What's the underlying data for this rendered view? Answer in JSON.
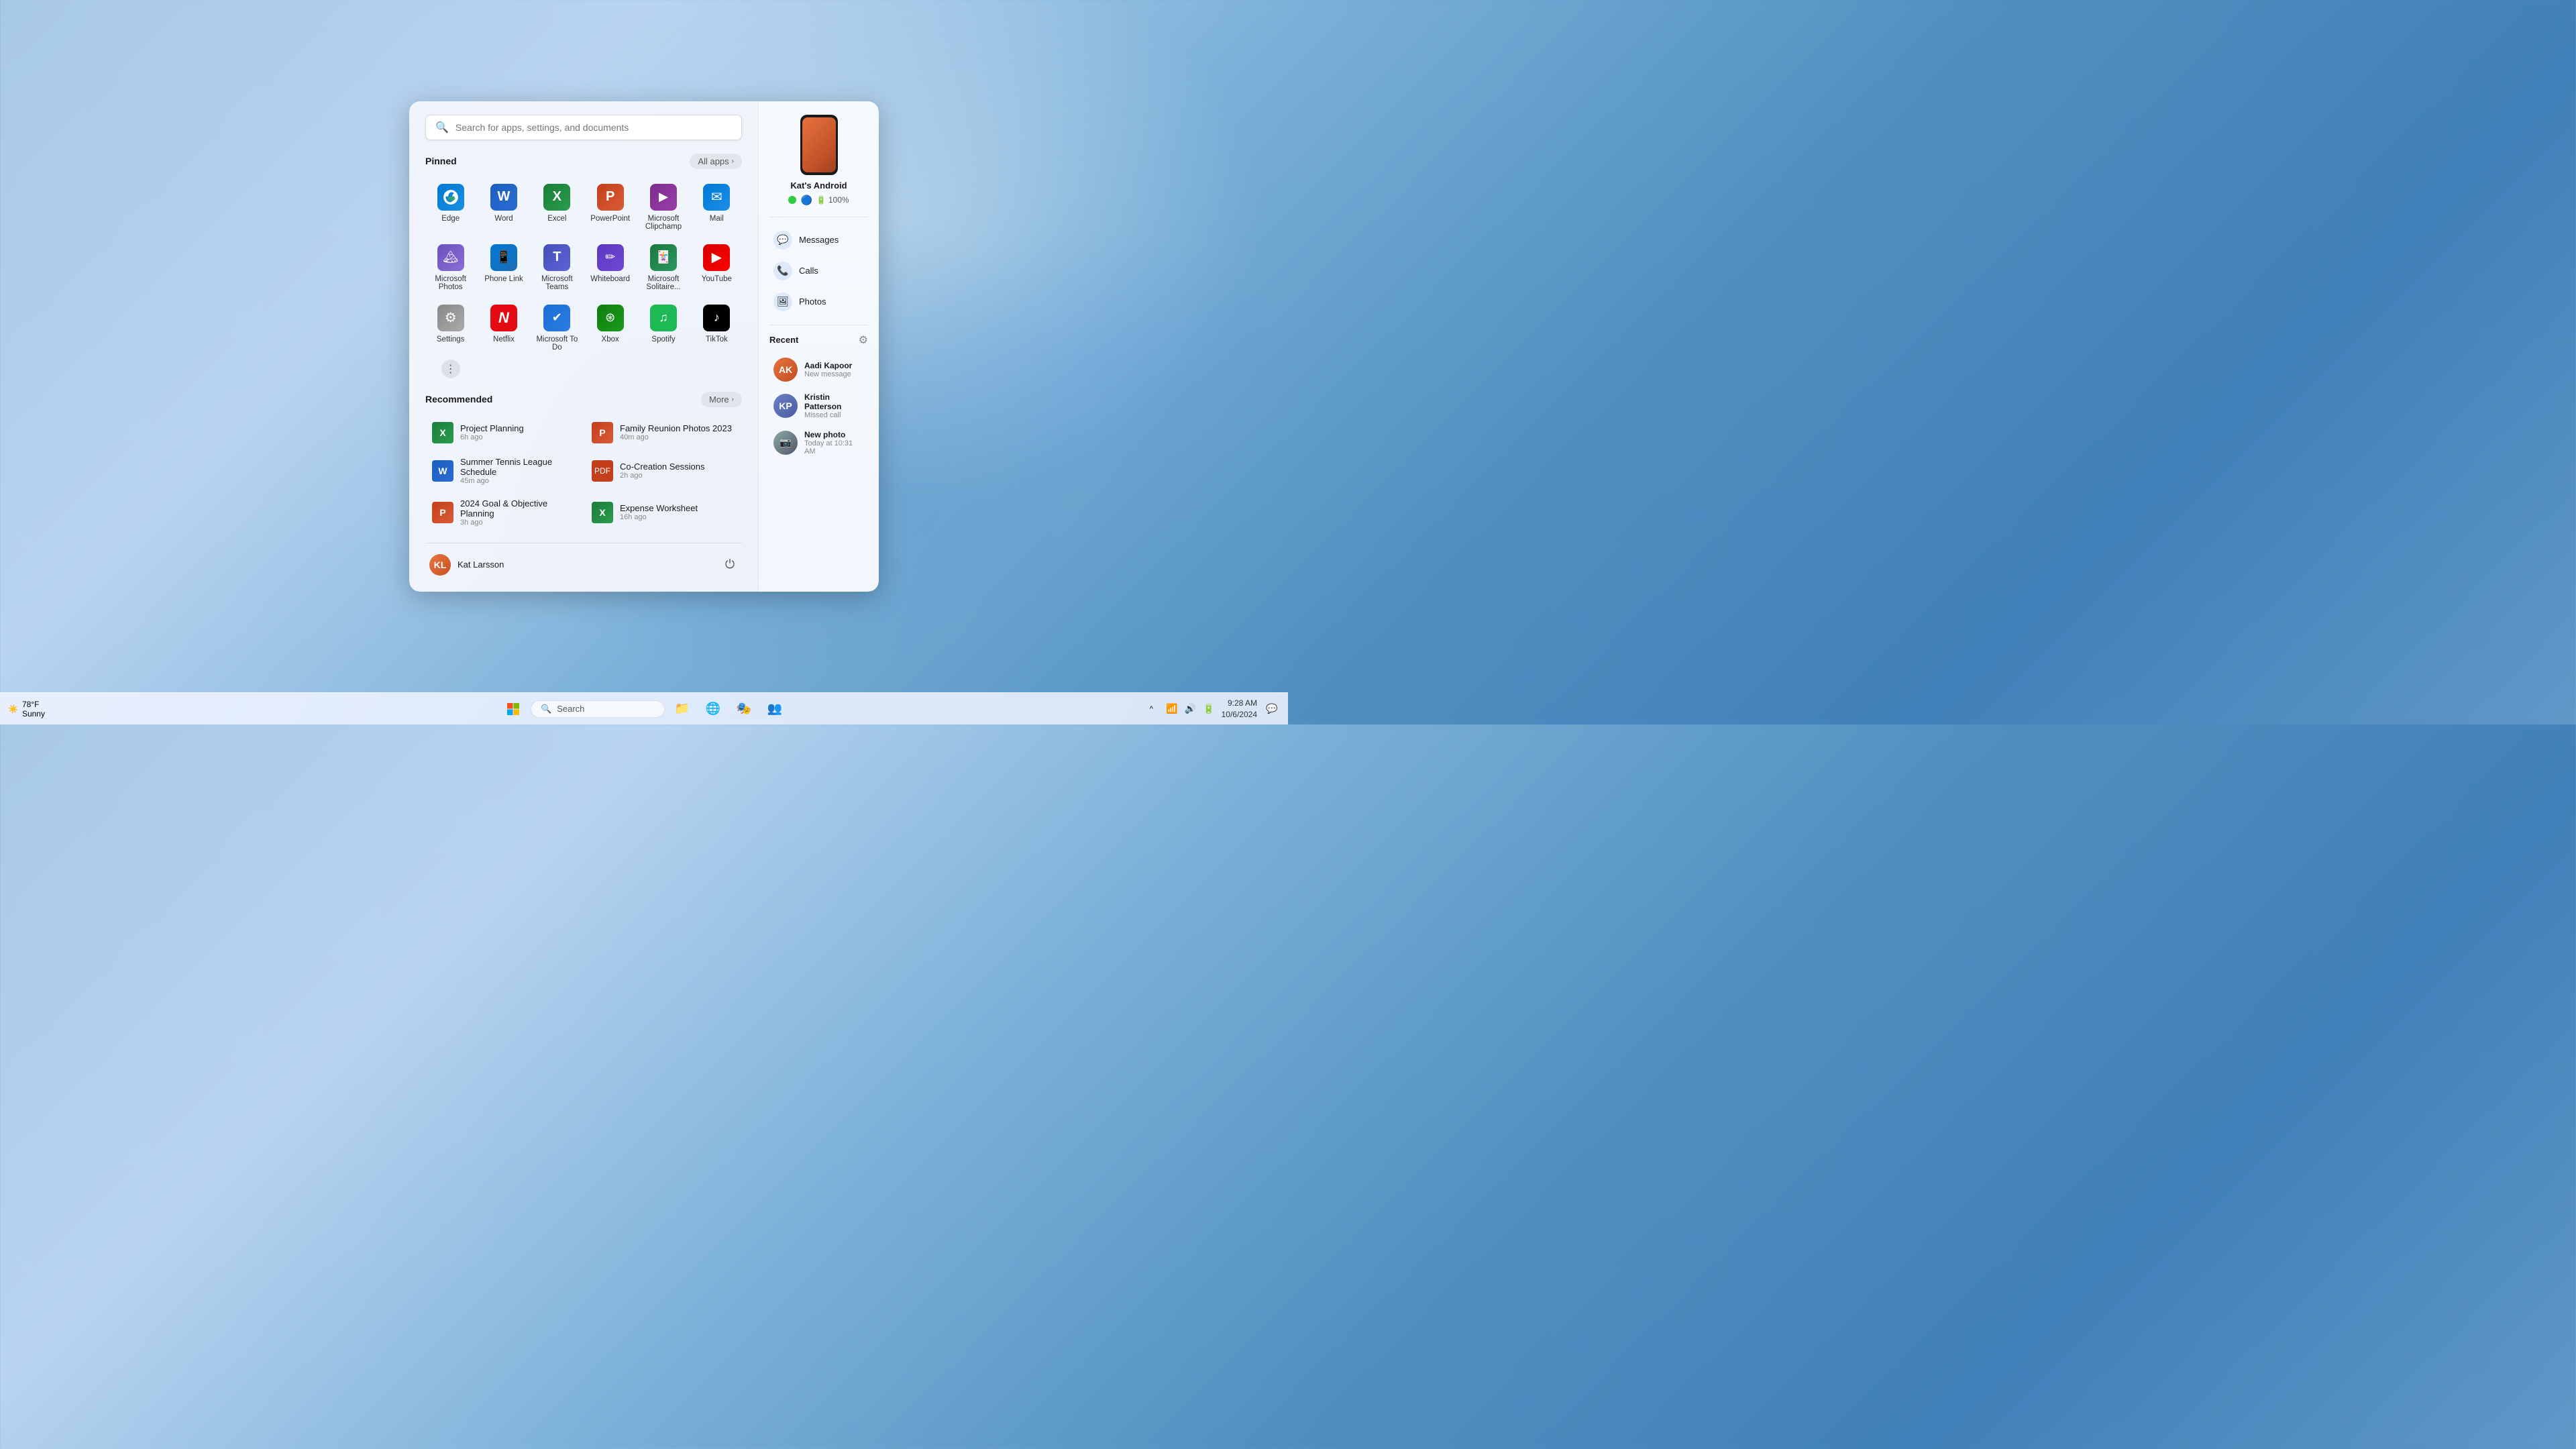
{
  "wallpaper": {
    "description": "Windows 11 blue swirl wallpaper"
  },
  "taskbar": {
    "weather": {
      "temp": "78°F",
      "condition": "Sunny"
    },
    "start_button_label": "Start",
    "search_placeholder": "Search",
    "clock": {
      "time": "9:28 AM",
      "date": "10/6/2024"
    },
    "apps": [
      {
        "name": "File Explorer",
        "icon": "📁"
      },
      {
        "name": "Browser",
        "icon": "🌐"
      },
      {
        "name": "Teams",
        "icon": "👥"
      }
    ]
  },
  "start_menu": {
    "search_placeholder": "Search for apps, settings, and documents",
    "pinned_label": "Pinned",
    "all_apps_label": "All apps",
    "recommended_label": "Recommended",
    "more_label": "More",
    "pinned_apps": [
      {
        "name": "Edge",
        "icon": "e",
        "bg": "edge"
      },
      {
        "name": "Word",
        "icon": "W",
        "bg": "word"
      },
      {
        "name": "Excel",
        "icon": "X",
        "bg": "excel"
      },
      {
        "name": "PowerPoint",
        "icon": "P",
        "bg": "ppt"
      },
      {
        "name": "Microsoft Clipchamp",
        "icon": "C",
        "bg": "clipchamp"
      },
      {
        "name": "Mail",
        "icon": "✉",
        "bg": "mail"
      },
      {
        "name": "Microsoft Photos",
        "icon": "🖼",
        "bg": "photos"
      },
      {
        "name": "Phone Link",
        "icon": "📱",
        "bg": "phonelink"
      },
      {
        "name": "Microsoft Teams",
        "icon": "T",
        "bg": "teams"
      },
      {
        "name": "Whiteboard",
        "icon": "W",
        "bg": "whiteboard"
      },
      {
        "name": "Microsoft Solitaire...",
        "icon": "🃏",
        "bg": "solitaire"
      },
      {
        "name": "YouTube",
        "icon": "▶",
        "bg": "youtube"
      },
      {
        "name": "Settings",
        "icon": "⚙",
        "bg": "settings"
      },
      {
        "name": "Netflix",
        "icon": "N",
        "bg": "netflix"
      },
      {
        "name": "Microsoft To Do",
        "icon": "✓",
        "bg": "todo"
      },
      {
        "name": "Xbox",
        "icon": "X",
        "bg": "xbox"
      },
      {
        "name": "Spotify",
        "icon": "♫",
        "bg": "spotify"
      },
      {
        "name": "TikTok",
        "icon": "♪",
        "bg": "tiktok"
      }
    ],
    "recommended_items": [
      {
        "name": "Project Planning",
        "time": "6h ago",
        "icon": "xlsx"
      },
      {
        "name": "Family Reunion Photos 2023",
        "time": "40m ago",
        "icon": "pdf"
      },
      {
        "name": "Summer Tennis League Schedule",
        "time": "45m ago",
        "icon": "docx"
      },
      {
        "name": "Co-Creation Sessions",
        "time": "2h ago",
        "icon": "pdf"
      },
      {
        "name": "2024 Goal & Objective Planning",
        "time": "3h ago",
        "icon": "pptx"
      },
      {
        "name": "Expense Worksheet",
        "time": "16h ago",
        "icon": "xlsx"
      }
    ],
    "user": {
      "name": "Kat Larsson",
      "initials": "KL"
    }
  },
  "phone_link": {
    "device_name": "Kat's Android",
    "battery": "100%",
    "actions": [
      {
        "label": "Messages",
        "icon": "💬"
      },
      {
        "label": "Calls",
        "icon": "📞"
      },
      {
        "label": "Photos",
        "icon": "🖼"
      }
    ],
    "recent_label": "Recent",
    "recent_contacts": [
      {
        "name": "Aadi Kapoor",
        "status": "New message",
        "color": "#e87040"
      },
      {
        "name": "Kristin Patterson",
        "status": "Missed call",
        "color": "#6b7ec4"
      },
      {
        "name": "New photo",
        "status": "Today at 10:31 AM",
        "color": "#888",
        "is_photo": true
      }
    ]
  }
}
